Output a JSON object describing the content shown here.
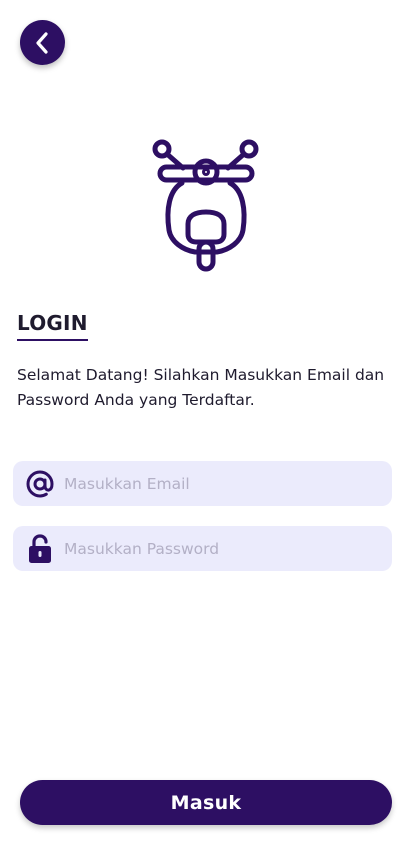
{
  "header": {
    "back_icon": "chevron-left-icon"
  },
  "hero": {
    "icon": "scooter-icon"
  },
  "login": {
    "title": "LOGIN",
    "subtitle": "Selamat Datang! Silahkan Masukkan Email dan Password Anda yang Terdaftar."
  },
  "form": {
    "email": {
      "icon": "at-sign-icon",
      "value": "",
      "placeholder": "Masukkan Email"
    },
    "password": {
      "icon": "unlocked-padlock-icon",
      "value": "",
      "placeholder": "Masukkan Password"
    }
  },
  "actions": {
    "submit_label": "Masuk"
  },
  "colors": {
    "primary": "#2d0f63",
    "field_background": "#ebebfc",
    "placeholder": "#b3b0c6",
    "text": "#1f1b2e",
    "background": "#ffffff"
  }
}
